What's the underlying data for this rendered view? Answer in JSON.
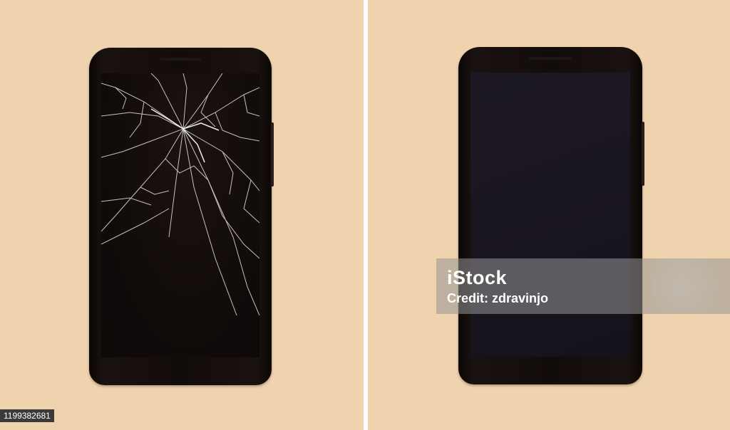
{
  "watermark": {
    "brand": "iStock",
    "credit": "Credit: zdravinjo"
  },
  "image_id": "1199382681",
  "colors": {
    "background": "#efd3ae",
    "phone_body": "#120c0a",
    "cracked_screen": "#120c0b",
    "intact_screen": "#1b1622"
  }
}
